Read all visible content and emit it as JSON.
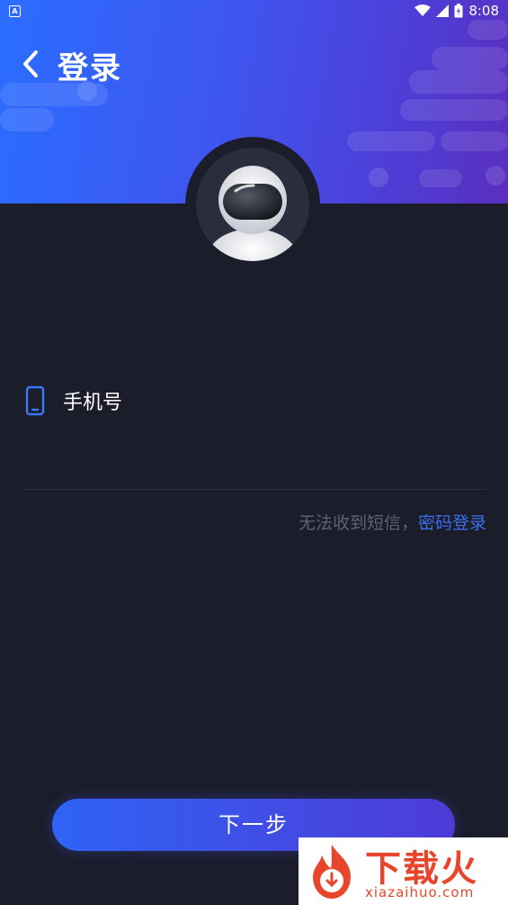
{
  "status_bar": {
    "time": "8:08",
    "left_icon": "notification-a-icon",
    "right_icons": [
      "wifi-icon",
      "signal-icon",
      "battery-icon"
    ]
  },
  "header": {
    "back_icon": "chevron-left-icon",
    "title": "登录",
    "gradient": [
      "#2b6dff",
      "#5a2fbf"
    ]
  },
  "avatar": {
    "icon": "astronaut-avatar-icon"
  },
  "phone_field": {
    "icon": "mobile-phone-icon",
    "label": "手机号",
    "value": ""
  },
  "hint": {
    "text": "无法收到短信，",
    "link": "密码登录",
    "link_color": "#3a6ef0"
  },
  "next_button": {
    "label": "下一步"
  },
  "watermark": {
    "text": "下载火",
    "url": "xiazaihuo.com",
    "color": "#e8462c"
  }
}
